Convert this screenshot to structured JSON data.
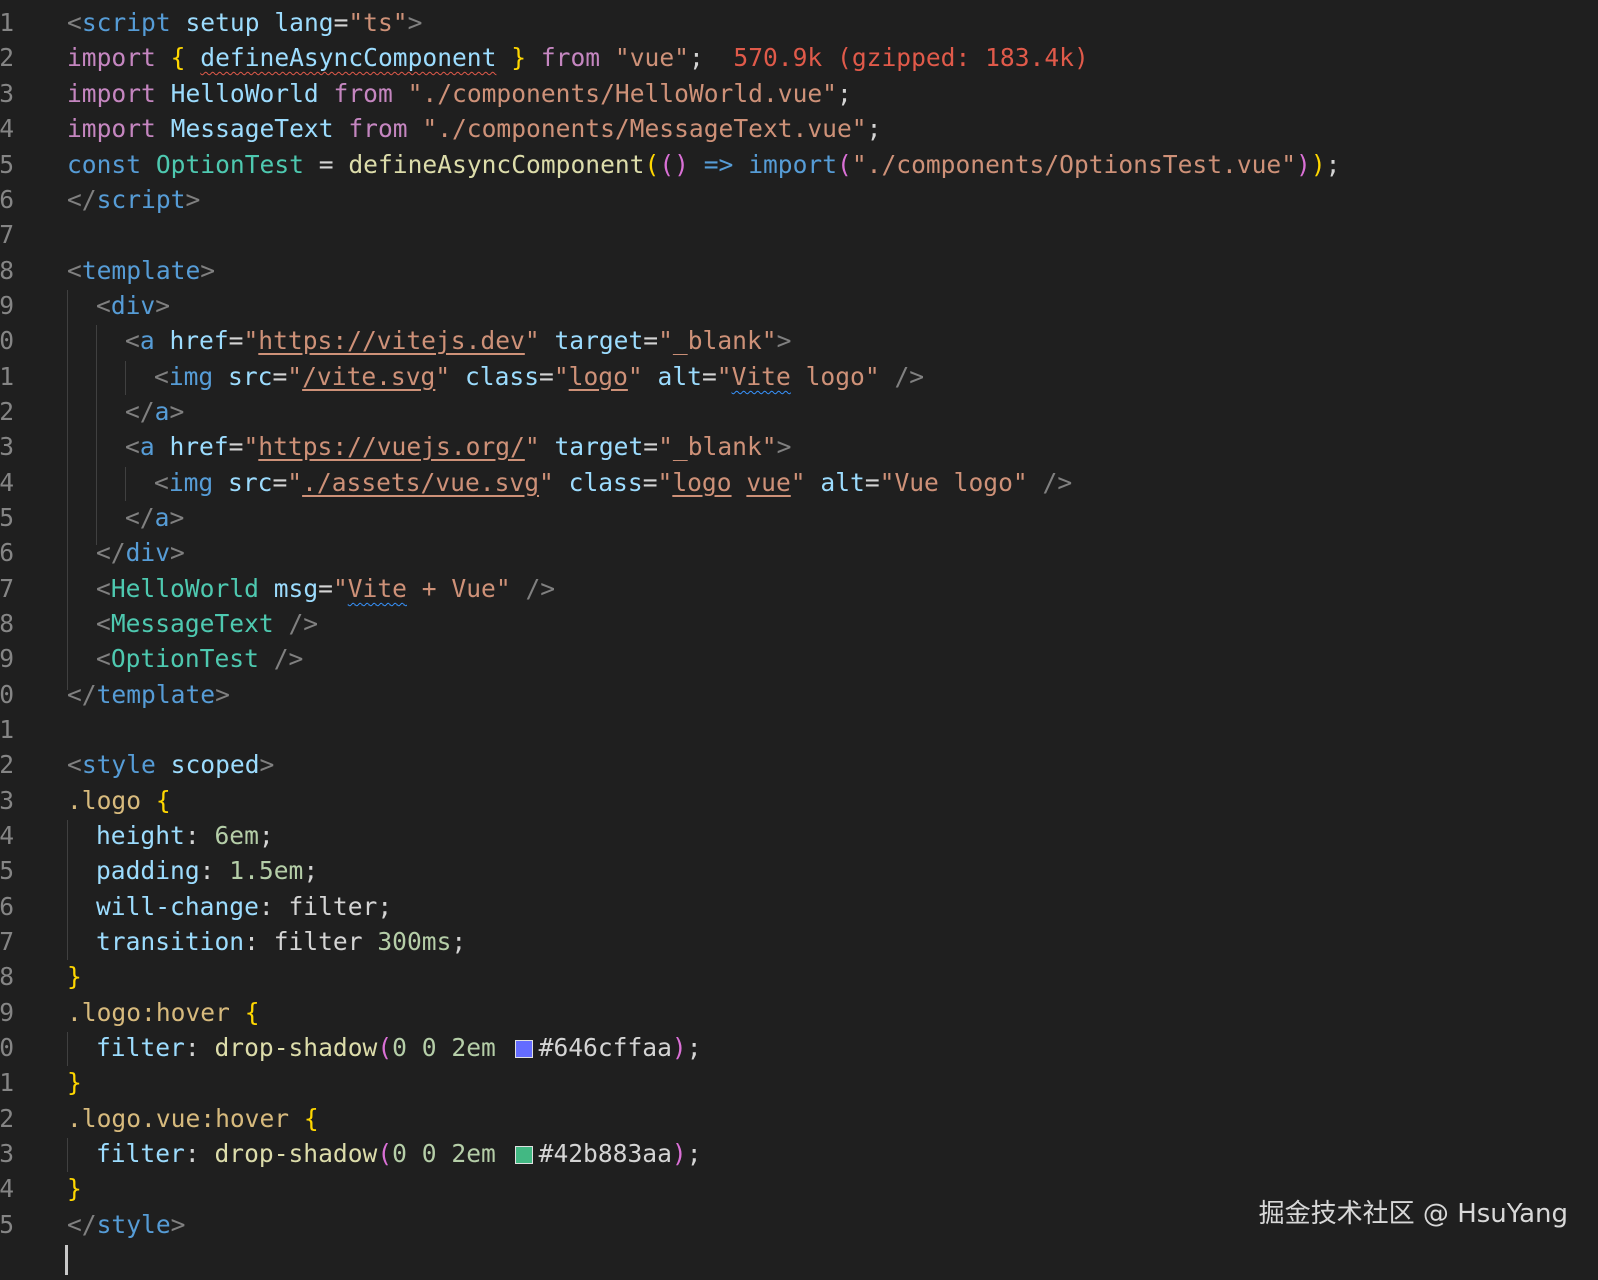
{
  "editor": {
    "line_numbers": [
      "1",
      "2",
      "3",
      "4",
      "5",
      "6",
      "7",
      "8",
      "9",
      "0",
      "1",
      "2",
      "3",
      "4",
      "5",
      "6",
      "7",
      "8",
      "9",
      "0",
      "1",
      "2",
      "3",
      "4",
      "5",
      "6",
      "7",
      "8",
      "9",
      "0",
      "1",
      "2",
      "3",
      "4",
      "5"
    ],
    "colors": {
      "background": "#1f1f1f",
      "swatch_1": "#646cff",
      "swatch_2": "#42b883"
    },
    "lines": {
      "l1": [
        "<",
        "script",
        " ",
        "setup",
        " ",
        "lang",
        "=",
        "\"ts\"",
        ">"
      ],
      "l2": [
        "import",
        " ",
        "{",
        " ",
        "defineAsyncComponent",
        " ",
        "}",
        " ",
        "from",
        " ",
        "\"vue\"",
        ";",
        "  ",
        "570.9k (gzipped: 183.4k)"
      ],
      "l3": [
        "import",
        " ",
        "HelloWorld",
        " ",
        "from",
        " ",
        "\"./components/HelloWorld.vue\"",
        ";"
      ],
      "l4": [
        "import",
        " ",
        "MessageText",
        " ",
        "from",
        " ",
        "\"./components/MessageText.vue\"",
        ";"
      ],
      "l5": [
        "const",
        " ",
        "OptionTest",
        " = ",
        "defineAsyncComponent",
        "(",
        "()",
        " ",
        "=>",
        " ",
        "import",
        "(",
        "\"./components/OptionsTest.vue\"",
        ")",
        ")",
        ";"
      ],
      "l6": [
        "</",
        "script",
        ">"
      ],
      "l8": [
        "<",
        "template",
        ">"
      ],
      "l9": [
        "<",
        "div",
        ">"
      ],
      "l10": [
        "<",
        "a",
        " ",
        "href",
        "=",
        "\"",
        "https://vitejs.dev",
        "\"",
        " ",
        "target",
        "=",
        "\"_blank\"",
        ">"
      ],
      "l11": [
        "<",
        "img",
        " ",
        "src",
        "=",
        "\"",
        "/vite.svg",
        "\"",
        " ",
        "class",
        "=",
        "\"",
        "logo",
        "\"",
        " ",
        "alt",
        "=",
        "\"",
        "Vite",
        " logo\"",
        " ",
        "/>"
      ],
      "l12": [
        "</",
        "a",
        ">"
      ],
      "l13": [
        "<",
        "a",
        " ",
        "href",
        "=",
        "\"",
        "https://vuejs.org/",
        "\"",
        " ",
        "target",
        "=",
        "\"_blank\"",
        ">"
      ],
      "l14": [
        "<",
        "img",
        " ",
        "src",
        "=",
        "\"",
        "./assets/vue.svg",
        "\"",
        " ",
        "class",
        "=",
        "\"",
        "logo",
        " ",
        "vue",
        "\"",
        " ",
        "alt",
        "=",
        "\"Vue logo\"",
        " ",
        "/>"
      ],
      "l15": [
        "</",
        "a",
        ">"
      ],
      "l16": [
        "</",
        "div",
        ">"
      ],
      "l17": [
        "<",
        "HelloWorld",
        " ",
        "msg",
        "=",
        "\"",
        "Vite",
        " + Vue\"",
        " ",
        "/>"
      ],
      "l18": [
        "<",
        "MessageText",
        " ",
        "/>"
      ],
      "l19": [
        "<",
        "OptionTest",
        " ",
        "/>"
      ],
      "l20": [
        "</",
        "template",
        ">"
      ],
      "l22": [
        "<",
        "style",
        " ",
        "scoped",
        ">"
      ],
      "l23": [
        ".logo",
        " ",
        "{"
      ],
      "l24": [
        "height",
        ": ",
        "6em",
        ";"
      ],
      "l25": [
        "padding",
        ": ",
        "1.5em",
        ";"
      ],
      "l26": [
        "will-change",
        ": ",
        "filter",
        ";"
      ],
      "l27": [
        "transition",
        ": ",
        "filter",
        " ",
        "300ms",
        ";"
      ],
      "l28": [
        "}"
      ],
      "l29": [
        ".logo:hover",
        " ",
        "{"
      ],
      "l30": [
        "filter",
        ": ",
        "drop-shadow",
        "(",
        "0",
        " ",
        "0",
        " ",
        "2em",
        " ",
        "#646cffaa",
        ")",
        ";"
      ],
      "l31": [
        "}"
      ],
      "l32": [
        ".logo.vue:hover",
        " ",
        "{"
      ],
      "l33": [
        "filter",
        ": ",
        "drop-shadow",
        "(",
        "0",
        " ",
        "0",
        " ",
        "2em",
        " ",
        "#42b883aa",
        ")",
        ";"
      ],
      "l34": [
        "}"
      ],
      "l35": [
        "</",
        "style",
        ">"
      ]
    }
  },
  "watermark": "掘金技术社区 @ HsuYang"
}
